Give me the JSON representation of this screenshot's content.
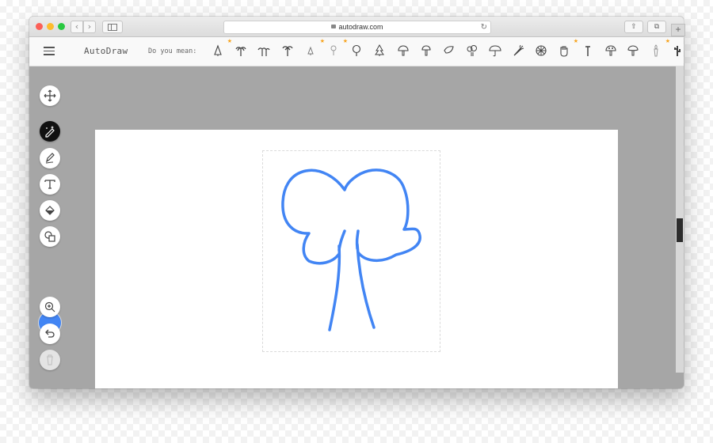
{
  "browser": {
    "url": "autodraw.com",
    "back_icon": "‹",
    "forward_icon": "›",
    "reload_icon": "↻",
    "share_icon": "⇧",
    "tabs_icon": "⧉",
    "plus_label": "+"
  },
  "app": {
    "name": "AutoDraw",
    "suggest_label": "Do you mean:",
    "suggestions": [
      {
        "name": "pine-tree-outline-icon",
        "starred": true
      },
      {
        "name": "palm-tree-icon",
        "starred": false
      },
      {
        "name": "palm-trees-icon",
        "starred": false
      },
      {
        "name": "palm-tree-single-icon",
        "starred": false
      },
      {
        "name": "small-tree-icon",
        "starred": true
      },
      {
        "name": "lamp-icon",
        "starred": true
      },
      {
        "name": "tree-round-icon",
        "starred": false
      },
      {
        "name": "pine-tree-icon",
        "starred": false
      },
      {
        "name": "mushroom-icon",
        "starred": false
      },
      {
        "name": "mushroom-outline-icon",
        "starred": false
      },
      {
        "name": "leaf-icon",
        "starred": false
      },
      {
        "name": "broccoli-icon",
        "starred": false
      },
      {
        "name": "umbrella-icon",
        "starred": false
      },
      {
        "name": "carrot-icon",
        "starred": false
      },
      {
        "name": "wheel-icon",
        "starred": false
      },
      {
        "name": "hand-icon",
        "starred": true
      },
      {
        "name": "nail-icon",
        "starred": false
      },
      {
        "name": "mushroom-spotted-icon",
        "starred": false
      },
      {
        "name": "mushroom-cap-icon",
        "starred": false
      },
      {
        "name": "torch-icon",
        "starred": true
      },
      {
        "name": "cactus-icon",
        "starred": false
      }
    ]
  },
  "tools": [
    {
      "name": "move-tool",
      "icon": "move-icon"
    },
    {
      "name": "autodraw-tool",
      "icon": "autodraw-pen-icon",
      "active": true
    },
    {
      "name": "draw-tool",
      "icon": "pencil-icon"
    },
    {
      "name": "text-tool",
      "icon": "text-icon"
    },
    {
      "name": "fill-tool",
      "icon": "fill-bucket-icon"
    },
    {
      "name": "shape-tool",
      "icon": "shapes-icon"
    },
    {
      "name": "color-picker",
      "color": "#4285f4"
    },
    {
      "name": "zoom-tool",
      "icon": "zoom-in-icon"
    },
    {
      "name": "undo-tool",
      "icon": "undo-icon"
    },
    {
      "name": "delete-tool",
      "icon": "trash-icon",
      "disabled": true
    }
  ],
  "colors": {
    "stroke": "#4285f4",
    "workspace": "#a6a6a6",
    "star": "#f7a21b"
  }
}
